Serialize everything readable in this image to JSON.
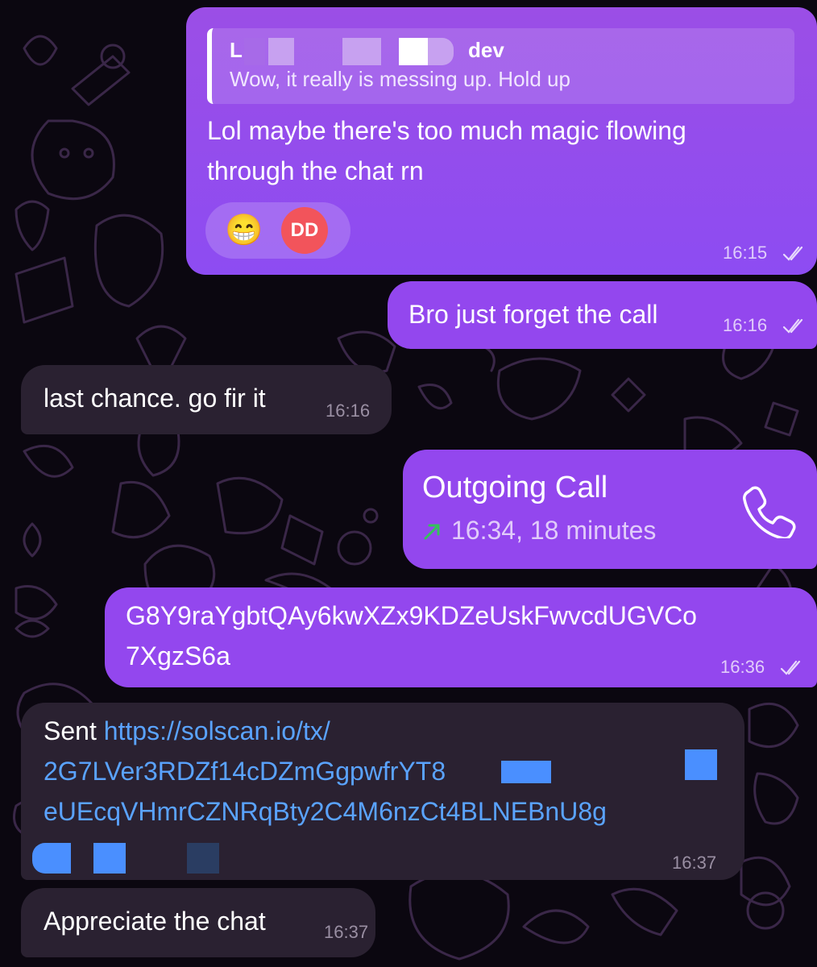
{
  "colors": {
    "outgoing_bubble": "#9347ee",
    "incoming_bubble": "#2a2131",
    "link": "#5aa3ff",
    "call_arrow": "#35c25a",
    "reaction_badge": "#f2545b"
  },
  "messages": {
    "m1": {
      "reply_name_suffix": "dev",
      "reply_name_prefix": "L",
      "reply_text": "Wow, it really is messing up. Hold up",
      "text_line1": "Lol maybe there's too much magic flowing",
      "text_line2": "through the chat rn",
      "reaction_emoji": "😁",
      "reaction_initials": "DD",
      "time": "16:15"
    },
    "m2": {
      "text": "Bro just forget the call",
      "time": "16:16"
    },
    "m3": {
      "text": "last chance. go fir it",
      "time": "16:16"
    },
    "call": {
      "title": "Outgoing Call",
      "detail": "16:34, 18 minutes",
      "icon": "phone-icon"
    },
    "m4": {
      "text_line1": "G8Y9raYgbtQAy6kwXZx9KDZeUskFwvcdUGVCo",
      "text_line2": "7XgzS6a",
      "time": "16:36"
    },
    "m5": {
      "prefix": "Sent ",
      "link_line1": "https://solscan.io/tx/",
      "link_line2": "2G7LVer3RDZf14cDZmGgpwfrYT8",
      "link_line3": "eUEcqVHmrCZNRqBty2C4M6nzCt4BLNEBnU8g",
      "time": "16:37"
    },
    "m6": {
      "text": "Appreciate the chat",
      "time": "16:37"
    }
  }
}
